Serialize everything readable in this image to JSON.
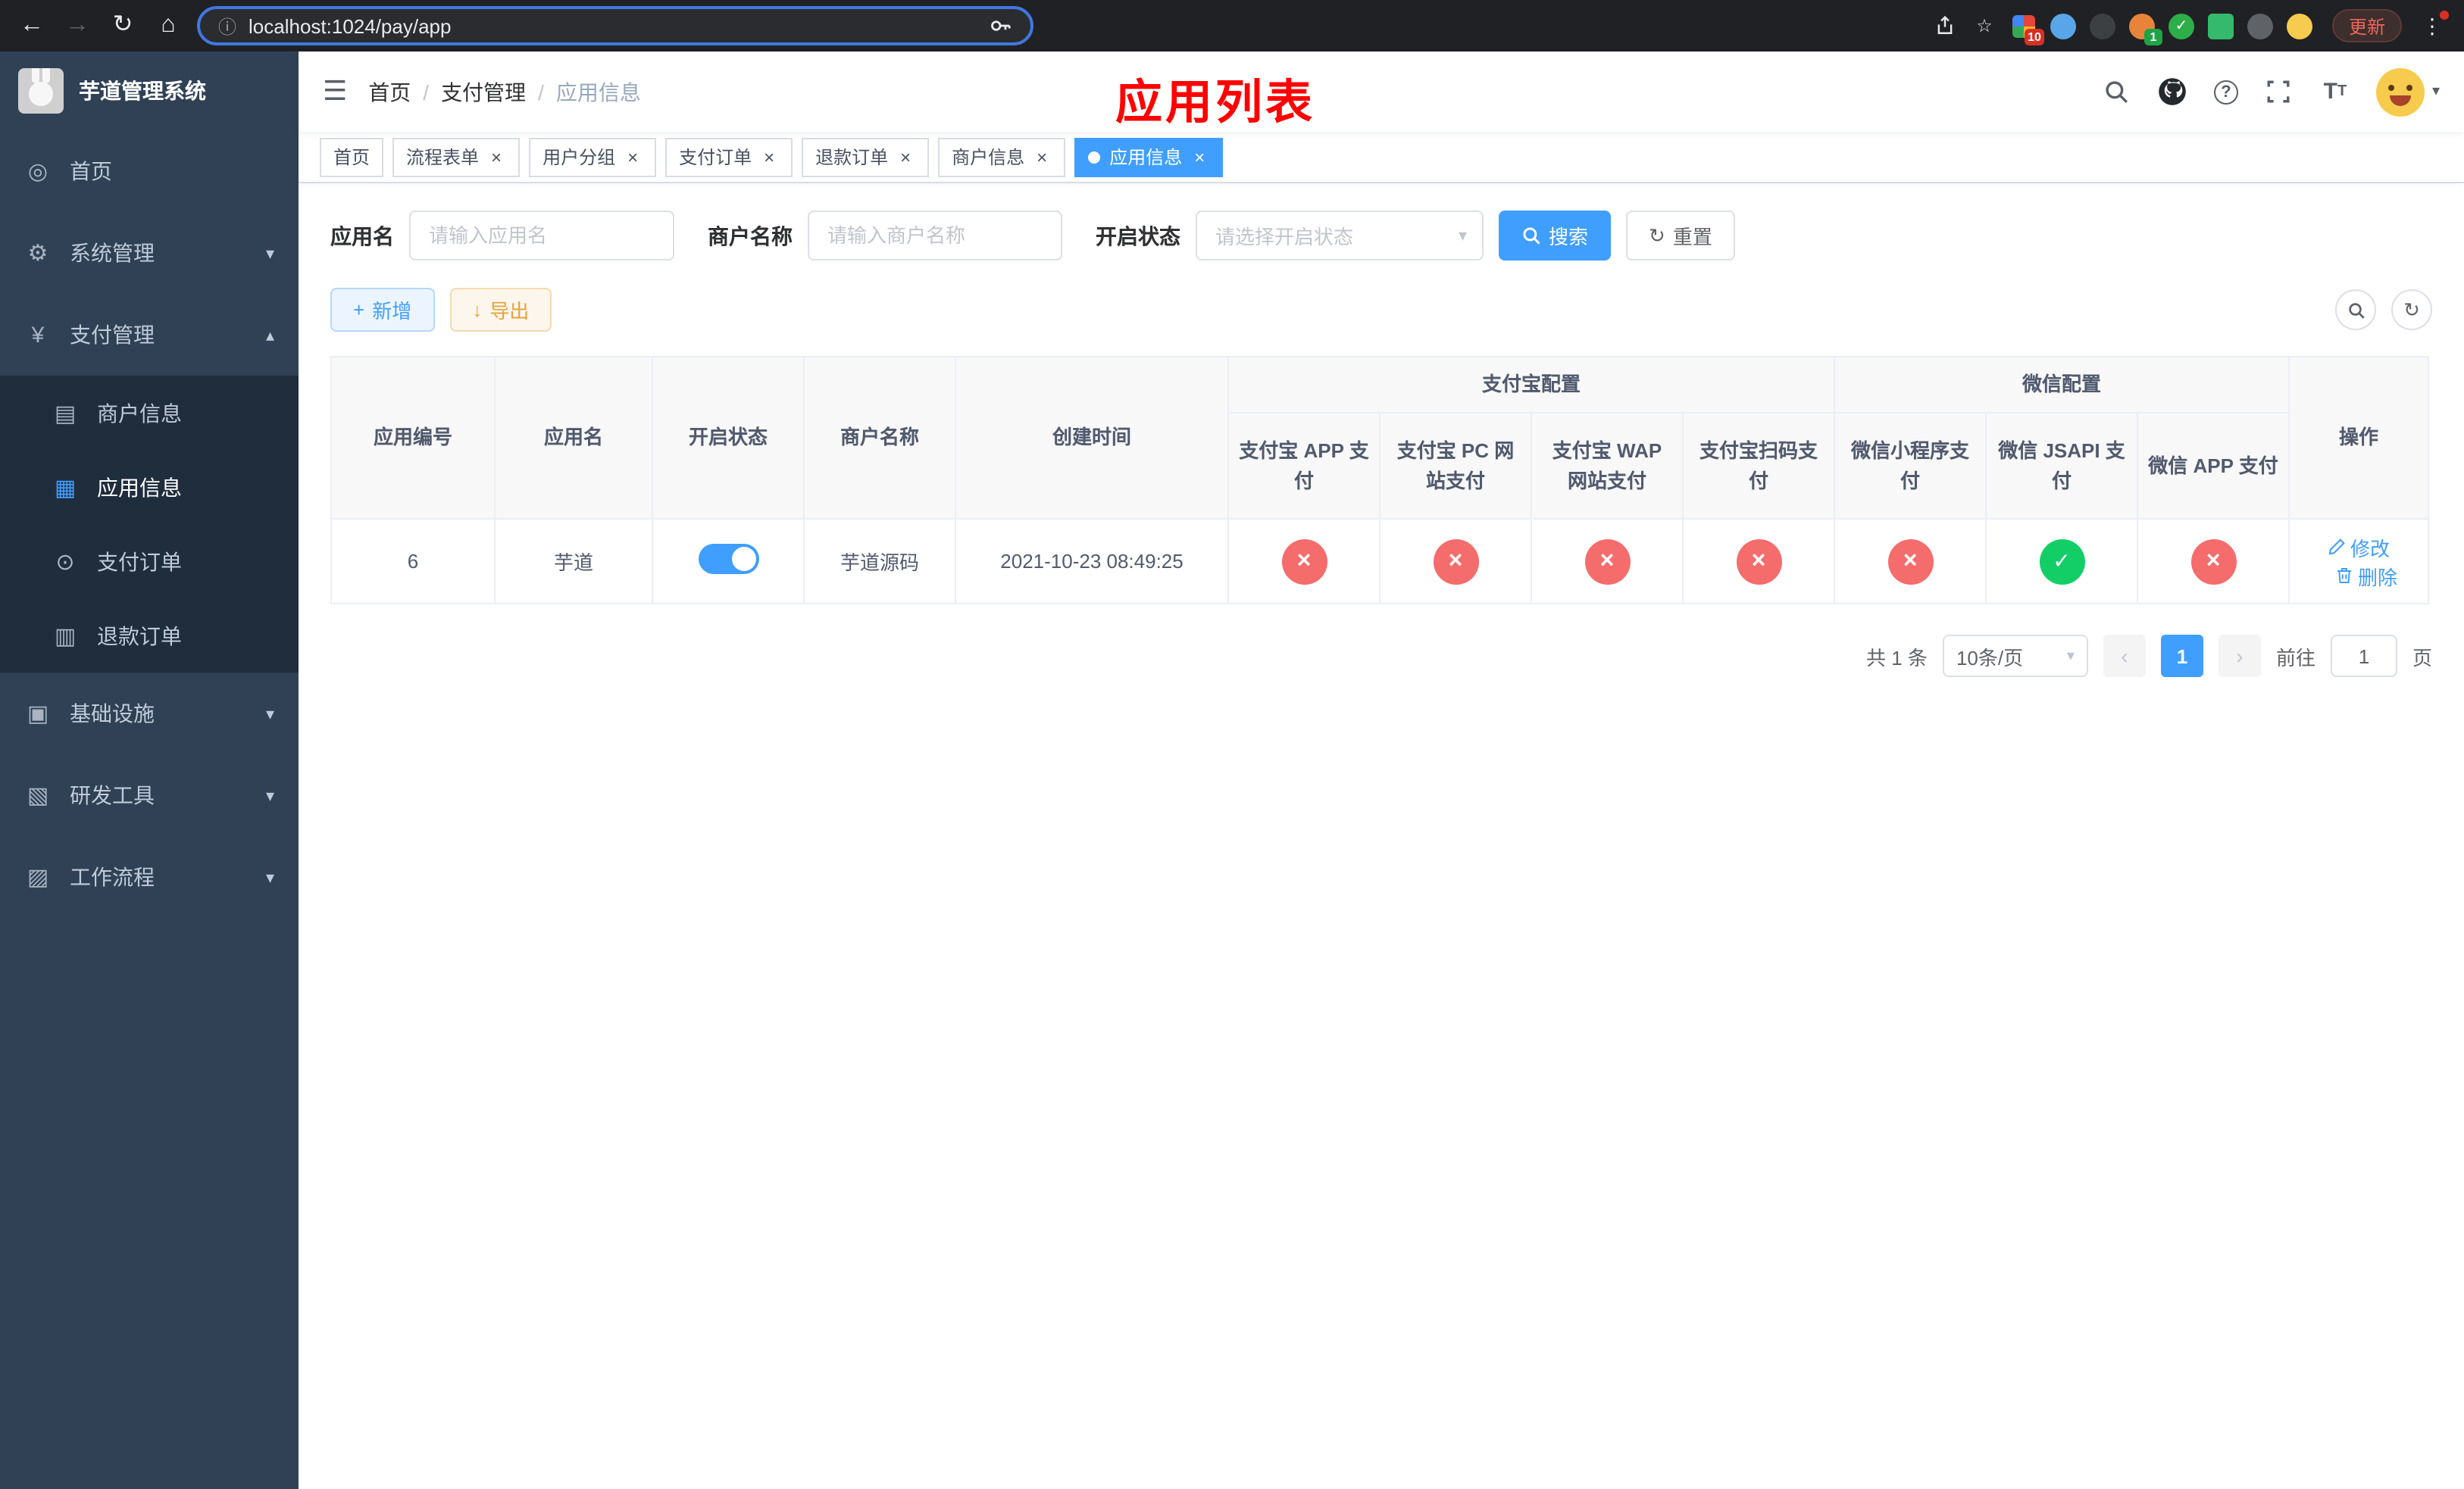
{
  "colors": {
    "primary": "#409eff",
    "success": "#13ce66",
    "danger": "#f56c6c",
    "warning": "#e6a23c",
    "sidebar_bg": "#304156",
    "submenu_bg": "#1f2d3d",
    "annotation_red": "#ff0000"
  },
  "icons": {
    "back": "←",
    "forward": "→",
    "reload": "↻",
    "home": "⌂",
    "info": "ⓘ",
    "star": "☆",
    "check_small": "✓",
    "menu_dots": "⋮",
    "hamburger": "☰",
    "chevron_down": "▾",
    "chevron_up": "▴",
    "select_caret": "▾",
    "breadcrumb_sep": "/",
    "close": "×",
    "plus": "+",
    "download": "↓",
    "refresh": "↻",
    "help": "?",
    "text_size": "T",
    "prev": "‹",
    "next": "›",
    "dashboard": "◎",
    "gear": "⚙",
    "yen": "¥",
    "merchant": "▤",
    "app_grid": "▦",
    "order": "⊙",
    "refund": "▥",
    "infra": "▣",
    "devtools": "▧",
    "workflow": "▨"
  },
  "browser": {
    "url": "localhost:1024/pay/app",
    "update_label": "更新",
    "extension_badge_count": "10",
    "profile_badge_count": "1"
  },
  "sidebar": {
    "logo_title": "芋道管理系统",
    "items": [
      {
        "label": "首页"
      },
      {
        "label": "系统管理"
      },
      {
        "label": "支付管理"
      },
      {
        "label": "基础设施"
      },
      {
        "label": "研发工具"
      },
      {
        "label": "工作流程"
      }
    ],
    "payment_submenu": [
      {
        "label": "商户信息"
      },
      {
        "label": "应用信息",
        "active": true
      },
      {
        "label": "支付订单"
      },
      {
        "label": "退款订单"
      }
    ]
  },
  "header": {
    "breadcrumb": [
      {
        "label": "首页"
      },
      {
        "label": "支付管理"
      },
      {
        "label": "应用信息"
      }
    ],
    "annotation": "应用列表"
  },
  "tabs": [
    {
      "label": "首页",
      "closable": false
    },
    {
      "label": "流程表单",
      "closable": true
    },
    {
      "label": "用户分组",
      "closable": true
    },
    {
      "label": "支付订单",
      "closable": true
    },
    {
      "label": "退款订单",
      "closable": true
    },
    {
      "label": "商户信息",
      "closable": true
    },
    {
      "label": "应用信息",
      "closable": true,
      "active": true
    }
  ],
  "filters": {
    "app_name_label": "应用名",
    "app_name_placeholder": "请输入应用名",
    "merchant_label": "商户名称",
    "merchant_placeholder": "请输入商户名称",
    "status_label": "开启状态",
    "status_placeholder": "请选择开启状态",
    "search_button": "搜索",
    "reset_button": "重置"
  },
  "toolbar": {
    "add_button": "新增",
    "export_button": "导出"
  },
  "table": {
    "columns_simple": [
      "应用编号",
      "应用名",
      "开启状态",
      "商户名称",
      "创建时间"
    ],
    "alipay_group": "支付宝配置",
    "wechat_group": "微信配置",
    "alipay_columns": [
      "支付宝 APP 支付",
      "支付宝 PC 网站支付",
      "支付宝 WAP 网站支付",
      "支付宝扫码支付"
    ],
    "wechat_columns": [
      "微信小程序支付",
      "微信 JSAPI 支付",
      "微信 APP 支付"
    ],
    "actions_column": "操作",
    "row": {
      "id": "6",
      "name": "芋道",
      "enabled": true,
      "merchant": "芋道源码",
      "created_at": "2021-10-23 08:49:25",
      "alipay_app": false,
      "alipay_pc": false,
      "alipay_wap": false,
      "alipay_qr": false,
      "wechat_mini": false,
      "wechat_jsapi": true,
      "wechat_app": false,
      "edit_label": "修改",
      "delete_label": "删除"
    }
  },
  "pagination": {
    "total": "共 1 条",
    "page_size": "10条/页",
    "current_page": "1",
    "goto_prefix": "前往",
    "goto_value": "1",
    "goto_suffix": "页"
  }
}
